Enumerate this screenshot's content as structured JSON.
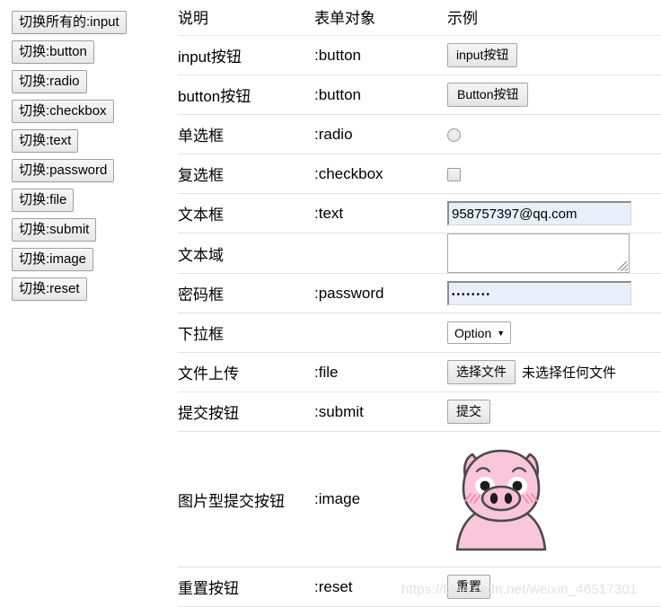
{
  "sidebar": {
    "buttons": [
      {
        "label": "切换所有的:input",
        "name": "toggle-all-input"
      },
      {
        "label": "切换:button",
        "name": "toggle-button"
      },
      {
        "label": "切换:radio",
        "name": "toggle-radio"
      },
      {
        "label": "切换:checkbox",
        "name": "toggle-checkbox"
      },
      {
        "label": "切换:text",
        "name": "toggle-text"
      },
      {
        "label": "切换:password",
        "name": "toggle-password"
      },
      {
        "label": "切换:file",
        "name": "toggle-file"
      },
      {
        "label": "切换:submit",
        "name": "toggle-submit"
      },
      {
        "label": "切换:image",
        "name": "toggle-image"
      },
      {
        "label": "切换:reset",
        "name": "toggle-reset"
      }
    ]
  },
  "table": {
    "headers": {
      "description": "说明",
      "form_object": "表单对象",
      "example": "示例"
    },
    "rows": [
      {
        "description": "input按钮",
        "form_object": ":button",
        "example_kind": "button",
        "example_label": "input按钮"
      },
      {
        "description": "button按钮",
        "form_object": ":button",
        "example_kind": "button",
        "example_label": "Button按钮"
      },
      {
        "description": "单选框",
        "form_object": ":radio",
        "example_kind": "radio",
        "example_label": ""
      },
      {
        "description": "复选框",
        "form_object": ":checkbox",
        "example_kind": "checkbox",
        "example_label": ""
      },
      {
        "description": "文本框",
        "form_object": ":text",
        "example_kind": "text",
        "example_label": "958757397@qq.com"
      },
      {
        "description": "文本域",
        "form_object": "",
        "example_kind": "textarea",
        "example_label": ""
      },
      {
        "description": "密码框",
        "form_object": ":password",
        "example_kind": "password",
        "example_label": "••••••••"
      },
      {
        "description": "下拉框",
        "form_object": "",
        "example_kind": "select",
        "example_label": "Option"
      },
      {
        "description": "文件上传",
        "form_object": ":file",
        "example_kind": "file",
        "example_label": "选择文件"
      },
      {
        "description": "提交按钮",
        "form_object": ":submit",
        "example_kind": "button",
        "example_label": "提交"
      },
      {
        "description": "图片型提交按钮",
        "form_object": ":image",
        "example_kind": "image",
        "example_label": ""
      },
      {
        "description": "重置按钮",
        "form_object": ":reset",
        "example_kind": "reset",
        "example_label": "重置"
      }
    ]
  },
  "file_upload": {
    "button_label": "选择文件",
    "status_text": "未选择任何文件"
  },
  "select": {
    "selected_option": "Option",
    "caret": "▼"
  },
  "password_field": {
    "masked_value": "••••••••"
  },
  "text_field": {
    "value": "958757397@qq.com"
  },
  "watermark": {
    "text": "https://blog.csdn.net/weixin_46517301"
  },
  "colors": {
    "page_background": "#ffffff",
    "text": "#000000",
    "row_border": "#e3e3e3",
    "button_border": "#a0a0a0",
    "autofill_background": "#e9eefb",
    "watermark": "#e2e2e2",
    "pig_body": "#f7bdd4",
    "pig_outline": "#4a4a4a",
    "pig_blush": "#f48fb1"
  }
}
